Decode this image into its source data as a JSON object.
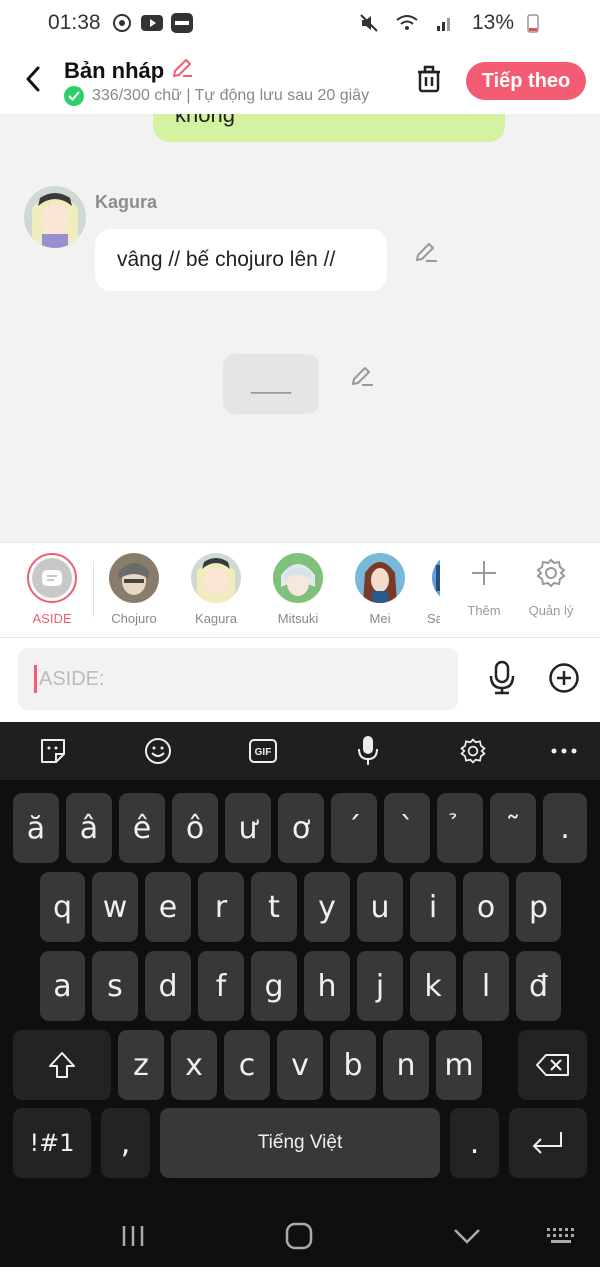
{
  "status": {
    "time": "01:38",
    "battery": "13%"
  },
  "header": {
    "title": "Bản nháp",
    "subtitle": "336/300 chữ | Tự động lưu sau 20 giây",
    "next_label": "Tiếp theo"
  },
  "chat": {
    "prev_bubble_text": "không",
    "speaker": "Kagura",
    "message": "vâng // bế chojuro lên //",
    "aside_text": "____"
  },
  "characters": [
    {
      "label": "ASIDE"
    },
    {
      "label": "Chojuro"
    },
    {
      "label": "Kagura"
    },
    {
      "label": "Mitsuki"
    },
    {
      "label": "Mei"
    },
    {
      "label": "Sa"
    }
  ],
  "tools": {
    "add_label": "Thêm",
    "manage_label": "Quản lý"
  },
  "input": {
    "placeholder": "ASIDE:"
  },
  "keyboard": {
    "toolbar": [
      "sticker-icon",
      "emoji-icon",
      "gif-icon",
      "mic-icon",
      "settings-icon",
      "more-icon"
    ],
    "gif_label": "GIF",
    "row1": [
      "ă",
      "â",
      "ê",
      "ô",
      "ư",
      "ơ",
      "´",
      "`",
      "̉",
      "˜",
      "."
    ],
    "row2": [
      "q",
      "w",
      "e",
      "r",
      "t",
      "y",
      "u",
      "i",
      "o",
      "p"
    ],
    "row3": [
      "a",
      "s",
      "d",
      "f",
      "g",
      "h",
      "j",
      "k",
      "l",
      "đ"
    ],
    "row4": [
      "z",
      "x",
      "c",
      "v",
      "b",
      "n",
      "m"
    ],
    "symbols_label": "!#1",
    "comma": ",",
    "space_label": "Tiếng Việt",
    "period": "."
  }
}
